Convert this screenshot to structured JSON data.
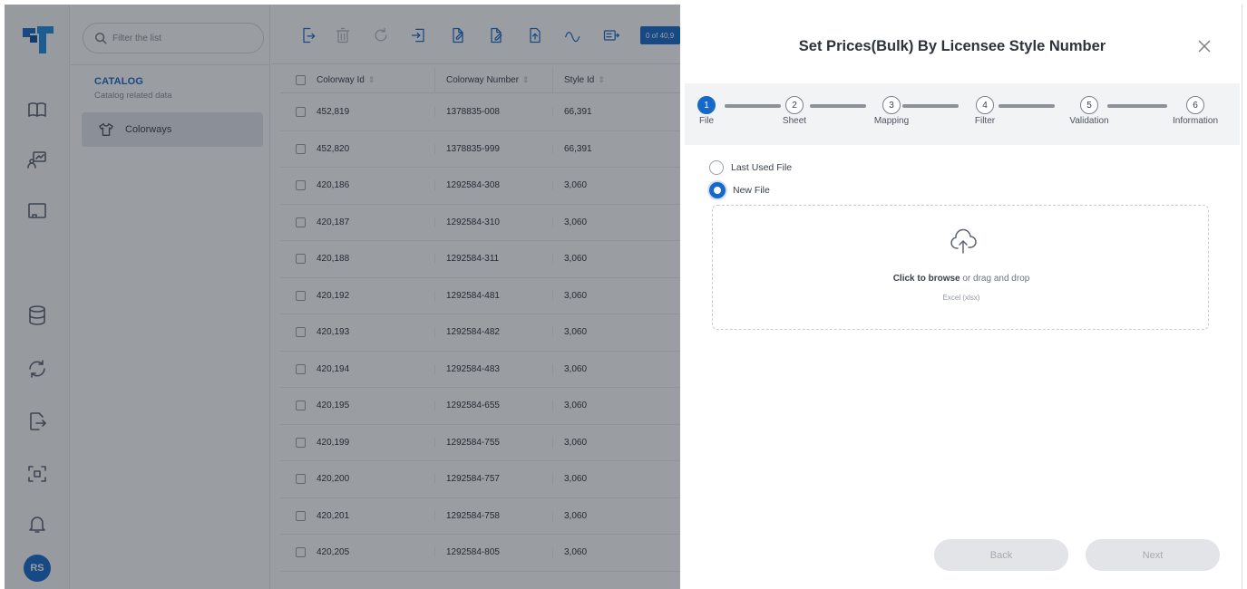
{
  "sidebar": {
    "filter_placeholder": "Filter the list",
    "section_title": "CATALOG",
    "section_subtitle": "Catalog related data",
    "item_label": "Colorways"
  },
  "rail": {
    "avatar_initials": "RS",
    "brand_color": "#1769c9"
  },
  "toolbar": {
    "count_badge": "0 of 40,9"
  },
  "table": {
    "columns": [
      "Colorway Id",
      "Colorway Number",
      "Style Id"
    ],
    "rows": [
      [
        "452,819",
        "1378835-008",
        "66,391"
      ],
      [
        "452,820",
        "1378835-999",
        "66,391"
      ],
      [
        "420,186",
        "1292584-308",
        "3,060"
      ],
      [
        "420,187",
        "1292584-310",
        "3,060"
      ],
      [
        "420,188",
        "1292584-311",
        "3,060"
      ],
      [
        "420,192",
        "1292584-481",
        "3,060"
      ],
      [
        "420,193",
        "1292584-482",
        "3,060"
      ],
      [
        "420,194",
        "1292584-483",
        "3,060"
      ],
      [
        "420,195",
        "1292584-655",
        "3,060"
      ],
      [
        "420,199",
        "1292584-755",
        "3,060"
      ],
      [
        "420,200",
        "1292584-757",
        "3,060"
      ],
      [
        "420,201",
        "1292584-758",
        "3,060"
      ],
      [
        "420,205",
        "1292584-805",
        "3,060"
      ]
    ]
  },
  "dialog": {
    "title": "Set Prices(Bulk) By Licensee Style Number",
    "steps": [
      {
        "num": "1",
        "label": "File"
      },
      {
        "num": "2",
        "label": "Sheet"
      },
      {
        "num": "3",
        "label": "Mapping"
      },
      {
        "num": "4",
        "label": "Filter"
      },
      {
        "num": "5",
        "label": "Validation"
      },
      {
        "num": "6",
        "label": "Information"
      }
    ],
    "radio_last": "Last Used File",
    "radio_new": "New File",
    "drop_browse": "Click to browse",
    "drop_rest": " or drag and drop",
    "drop_hint": "Excel (xlsx)",
    "back_label": "Back",
    "next_label": "Next"
  }
}
